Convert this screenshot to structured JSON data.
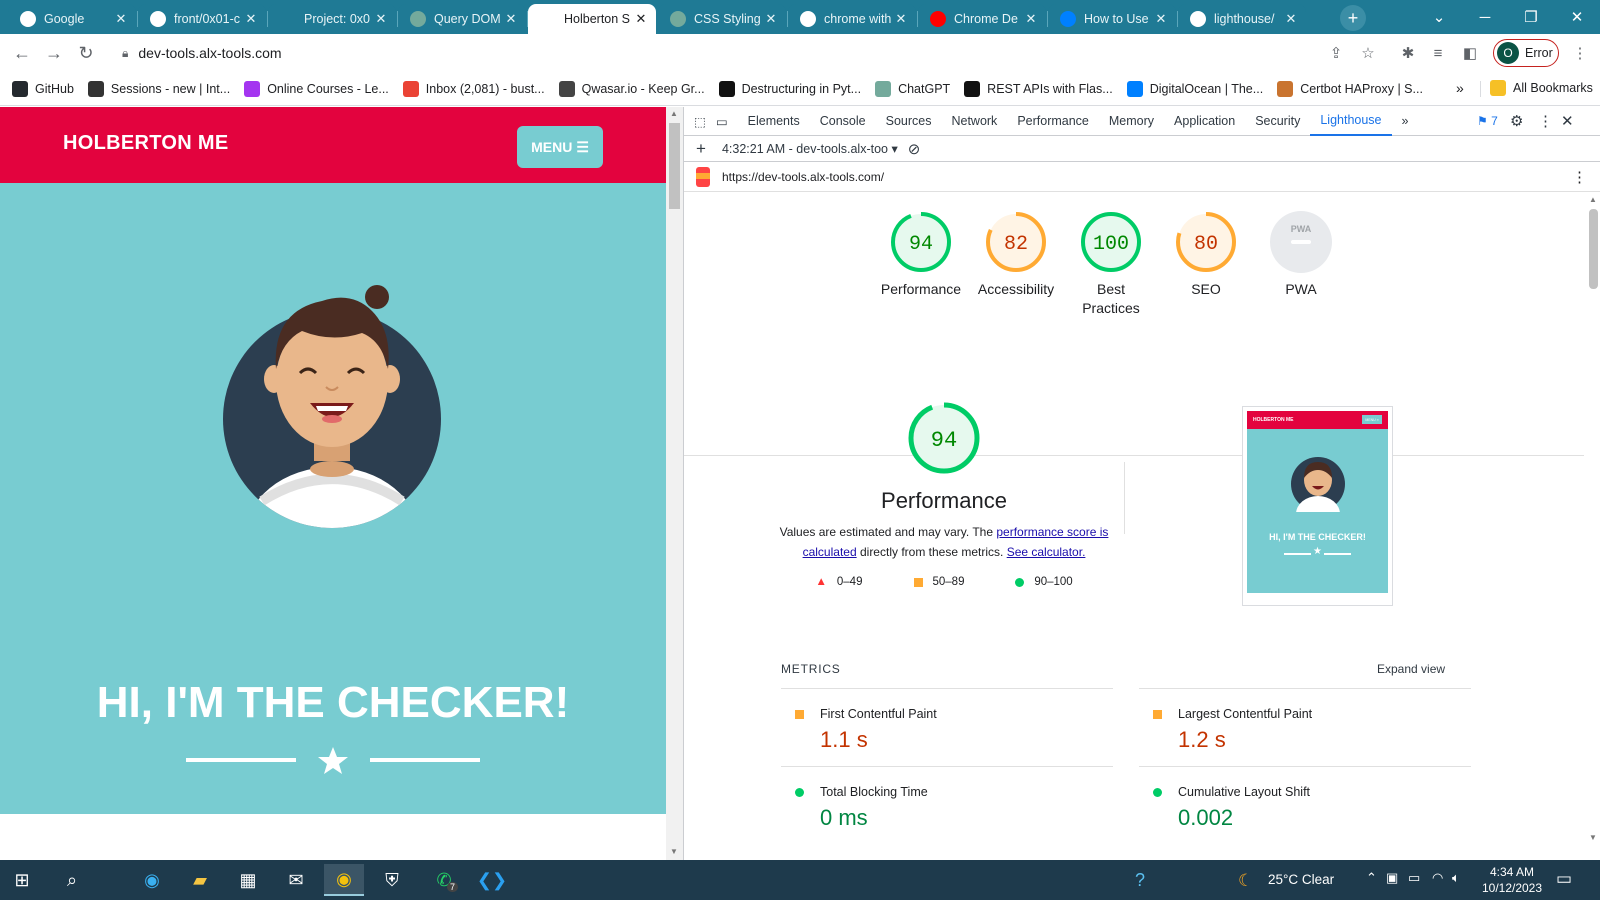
{
  "tabs": [
    {
      "title": "Google",
      "icon": "google-icon",
      "active": false
    },
    {
      "title": "front/0x01-c",
      "icon": "github-icon",
      "active": false
    },
    {
      "title": "Project: 0x0",
      "icon": "alx-icon",
      "active": false
    },
    {
      "title": "Query DOM",
      "icon": "chatgpt-icon",
      "active": false
    },
    {
      "title": "Holberton S",
      "icon": "holberton-icon",
      "active": true
    },
    {
      "title": "CSS Styling",
      "icon": "chatgpt-icon",
      "active": false
    },
    {
      "title": "chrome with",
      "icon": "google-icon",
      "active": false
    },
    {
      "title": "Chrome De",
      "icon": "youtube-icon",
      "active": false
    },
    {
      "title": "How to Use",
      "icon": "digitalocean-icon",
      "active": false
    },
    {
      "title": "lighthouse/",
      "icon": "github-icon",
      "active": false
    }
  ],
  "new_tab_symbol": "+",
  "address": "dev-tools.alx-tools.com",
  "profile": {
    "initial": "O",
    "label": "Error"
  },
  "bookmarks": [
    {
      "label": "GitHub",
      "icon": "github-icon"
    },
    {
      "label": "Sessions - new | Int...",
      "icon": "alx-icon"
    },
    {
      "label": "Online Courses - Le...",
      "icon": "udemy-icon"
    },
    {
      "label": "Inbox (2,081) - bust...",
      "icon": "gmail-icon"
    },
    {
      "label": "Qwasar.io - Keep Gr...",
      "icon": "qwasar-icon"
    },
    {
      "label": "Destructuring in Pyt...",
      "icon": "dev-icon"
    },
    {
      "label": "ChatGPT",
      "icon": "chatgpt-icon"
    },
    {
      "label": "REST APIs with Flas...",
      "icon": "dev-icon"
    },
    {
      "label": "DigitalOcean | The...",
      "icon": "digitalocean-icon"
    },
    {
      "label": "Certbot HAProxy | S...",
      "icon": "certbot-icon"
    }
  ],
  "bookmarks_overflow": "»",
  "all_bookmarks": "All Bookmarks",
  "site": {
    "brand": "HOLBERTON ME",
    "menu_label": "MENU",
    "hero_title": "HI, I'M THE CHECKER!"
  },
  "devtools": {
    "tabs": [
      "Elements",
      "Console",
      "Sources",
      "Network",
      "Performance",
      "Memory",
      "Application",
      "Security",
      "Lighthouse"
    ],
    "active_tab": "Lighthouse",
    "issues_count": "7",
    "report_time": "4:32:21 AM - dev-tools.alx-too",
    "report_url": "https://dev-tools.alx-tools.com/",
    "scores": [
      {
        "label": "Performance",
        "value": "94",
        "color": "#0c6",
        "fill": 0.94
      },
      {
        "label": "Accessibility",
        "value": "82",
        "color": "#fa3",
        "fill": 0.82
      },
      {
        "label": "Best Practices",
        "value": "100",
        "color": "#0c6",
        "fill": 1.0
      },
      {
        "label": "SEO",
        "value": "80",
        "color": "#fa3",
        "fill": 0.8
      },
      {
        "label": "PWA",
        "value": "",
        "color": "#9aa0a6",
        "fill": 0
      }
    ],
    "pwa_badge": "PWA",
    "perf": {
      "score": "94",
      "title": "Performance",
      "desc_before": "Values are estimated and may vary. The ",
      "desc_link1": "performance score is calculated",
      "desc_mid": " directly from these metrics. ",
      "desc_link2": "See calculator.",
      "legend": [
        "0–49",
        "50–89",
        "90–100"
      ]
    },
    "thumbnail": {
      "brand": "HOLBERTON ME",
      "menu": "MENU ≡",
      "title": "HI, I'M THE CHECKER!"
    },
    "metrics_heading": "METRICS",
    "expand_view": "Expand view",
    "metrics": [
      {
        "name": "First Contentful Paint",
        "value": "1.1 s",
        "status": "average",
        "color": "#c33300"
      },
      {
        "name": "Largest Contentful Paint",
        "value": "1.2 s",
        "status": "average",
        "color": "#c33300"
      },
      {
        "name": "Total Blocking Time",
        "value": "0 ms",
        "status": "pass",
        "color": "#018642"
      },
      {
        "name": "Cumulative Layout Shift",
        "value": "0.002",
        "status": "pass",
        "color": "#018642"
      }
    ]
  },
  "taskbar": {
    "weather": "25°C  Clear",
    "time": "4:34 AM",
    "date": "10/12/2023",
    "whatsapp_badge": "7"
  }
}
